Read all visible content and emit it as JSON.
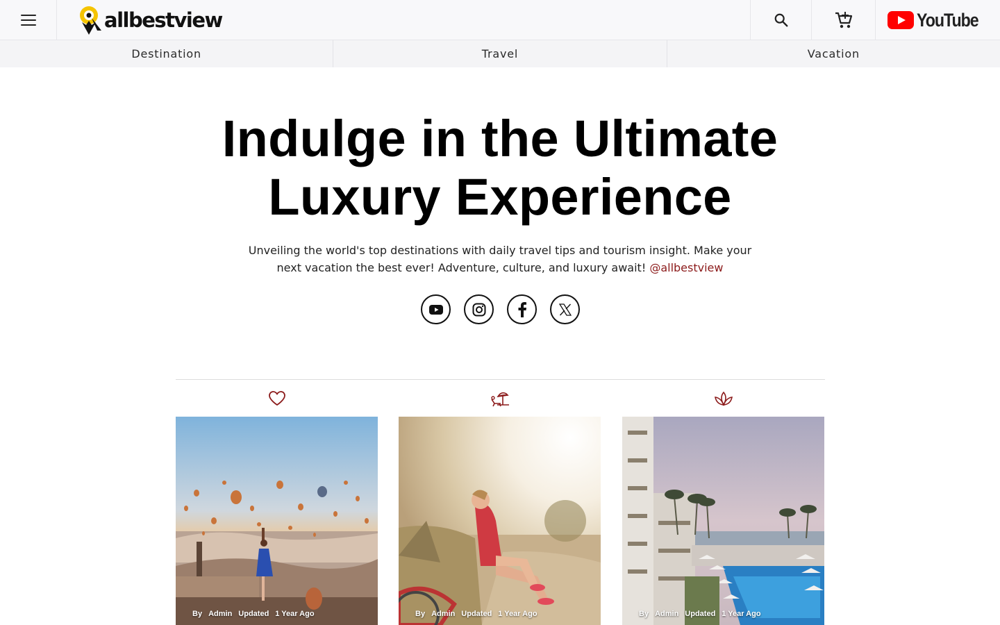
{
  "header": {
    "brand": "allbestview",
    "youtube_label": "YouTube",
    "icons": {
      "menu": "hamburger-menu-icon",
      "search": "search-icon",
      "cart": "add-to-cart-icon",
      "youtube": "youtube-logo-icon"
    }
  },
  "categories": [
    "Destination",
    "Travel",
    "Vacation"
  ],
  "hero": {
    "title_line1": "Indulge in the Ultimate",
    "title_line2": "Luxury Experience",
    "subtitle": "Unveiling the world's top destinations with daily travel tips and tourism insight. Make your next vacation the best ever! Adventure, culture, and luxury await! ",
    "handle": "@allbestview"
  },
  "socials": [
    {
      "name": "youtube",
      "icon": "youtube-icon"
    },
    {
      "name": "instagram",
      "icon": "instagram-icon"
    },
    {
      "name": "facebook",
      "icon": "facebook-icon"
    },
    {
      "name": "x",
      "icon": "x-icon"
    }
  ],
  "cards": [
    {
      "icon": "heart-icon",
      "by": "By",
      "author": "Admin",
      "updated": "Updated",
      "age": "1 Year Ago"
    },
    {
      "icon": "sunbed-umbrella-icon",
      "by": "By",
      "author": "Admin",
      "updated": "Updated",
      "age": "1 Year Ago"
    },
    {
      "icon": "lotus-icon",
      "by": "By",
      "author": "Admin",
      "updated": "Updated",
      "age": "1 Year Ago"
    }
  ],
  "colors": {
    "accent": "#8b1a1a",
    "youtube_red": "#ff0000",
    "logo_yellow": "#f5c400"
  }
}
